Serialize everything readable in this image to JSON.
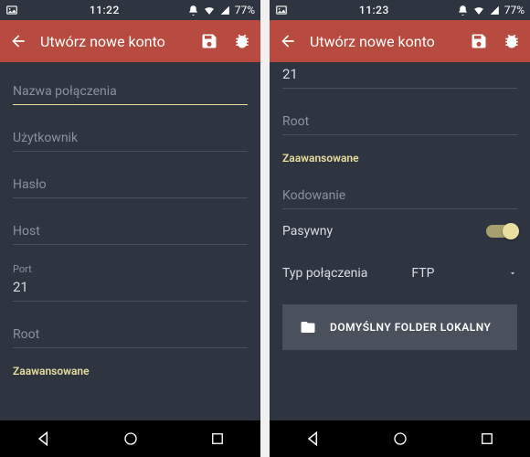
{
  "screens": [
    {
      "statusbar": {
        "time": "11:22",
        "battery": "77%"
      },
      "toolbar": {
        "title": "Utwórz nowe konto"
      },
      "fields": {
        "connection_name_placeholder": "Nazwa połączenia",
        "user_placeholder": "Użytkownik",
        "password_placeholder": "Hasło",
        "host_placeholder": "Host",
        "port_label": "Port",
        "port_value": "21",
        "root_placeholder": "Root"
      },
      "section_advanced": "Zaawansowane"
    },
    {
      "statusbar": {
        "time": "11:23",
        "battery": "77%"
      },
      "toolbar": {
        "title": "Utwórz nowe konto"
      },
      "fields": {
        "port_value_partial": "21",
        "root_placeholder": "Root",
        "encoding_placeholder": "Kodowanie",
        "passive_label": "Pasywny",
        "passive_on": true,
        "conn_type_label": "Typ połączenia",
        "conn_type_value": "FTP"
      },
      "section_advanced": "Zaawansowane",
      "default_folder_button": "DOMYŚLNY FOLDER LOKALNY"
    }
  ],
  "colors": {
    "accent": "#e8dfa0",
    "toolbar": "#b84b3f",
    "bg": "#2e3440"
  }
}
